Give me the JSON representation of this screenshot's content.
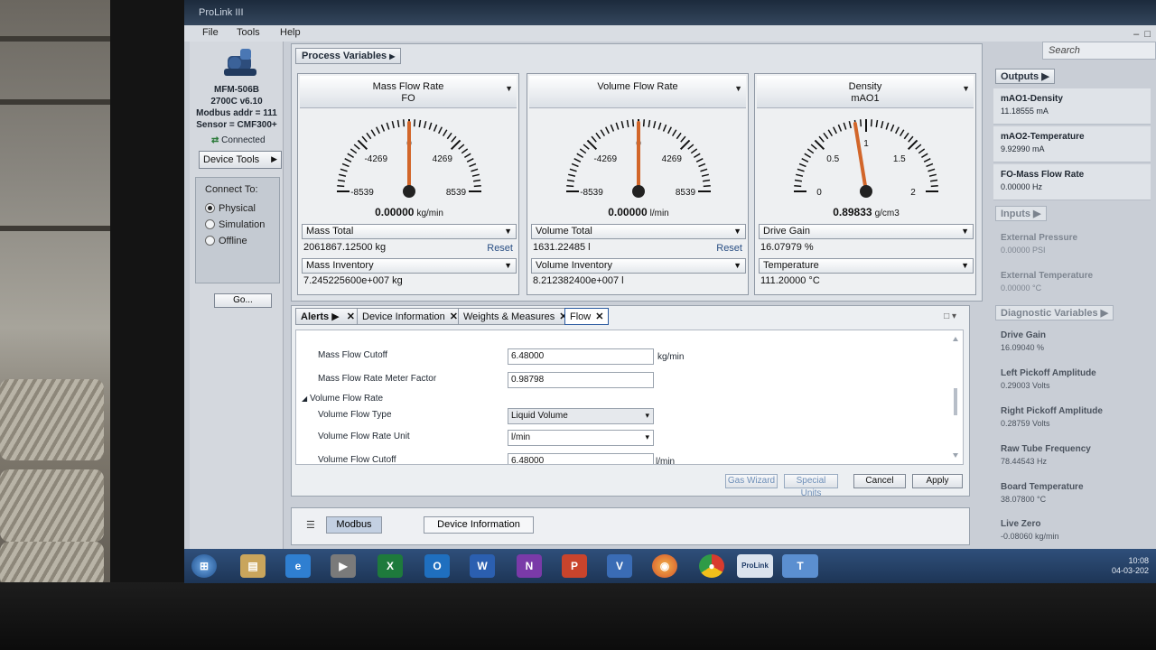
{
  "app": {
    "title": "ProLink III"
  },
  "menu": {
    "file": "File",
    "tools": "Tools",
    "help": "Help"
  },
  "search": {
    "placeholder": "Search"
  },
  "device": {
    "model": "MFM-506B",
    "version": "2700C v6.10",
    "modbus": "Modbus addr = 111",
    "sensor": "Sensor = CMF300+",
    "status": "Connected",
    "tools_label": "Device Tools"
  },
  "connect": {
    "label": "Connect To:",
    "options": [
      "Physical",
      "Simulation",
      "Offline"
    ],
    "selected": "Physical",
    "go_label": "Go..."
  },
  "process_variables": {
    "title": "Process Variables",
    "gauges": [
      {
        "name": "Mass Flow Rate",
        "sub": "FO",
        "ticks": [
          "-8539",
          "-4269",
          "0",
          "4269",
          "8539"
        ],
        "value": "0.00000",
        "unit": "kg/min",
        "needle_fraction": 0.5,
        "total_label": "Mass Total",
        "total_value": "2061867.12500 kg",
        "reset": "Reset",
        "inv_label": "Mass Inventory",
        "inv_value": "7.245225600e+007 kg"
      },
      {
        "name": "Volume Flow Rate",
        "sub": "",
        "ticks": [
          "-8539",
          "-4269",
          "0",
          "4269",
          "8539"
        ],
        "value": "0.00000",
        "unit": "l/min",
        "needle_fraction": 0.5,
        "total_label": "Volume Total",
        "total_value": "1631.22485 l",
        "reset": "Reset",
        "inv_label": "Volume Inventory",
        "inv_value": "8.212382400e+007 l"
      },
      {
        "name": "Density",
        "sub": "mAO1",
        "ticks": [
          "0",
          "0.5",
          "1",
          "1.5",
          "2"
        ],
        "value": "0.89833",
        "unit": "g/cm3",
        "needle_fraction": 0.449,
        "total_label": "Drive Gain",
        "total_value": "16.07979 %",
        "reset": "",
        "inv_label": "Temperature",
        "inv_value": "111.20000 °C"
      }
    ]
  },
  "outputs": {
    "title": "Outputs",
    "items": [
      {
        "name": "mAO1-Density",
        "value": "11.18555  mA"
      },
      {
        "name": "mAO2-Temperature",
        "value": "9.92990  mA"
      },
      {
        "name": "FO-Mass Flow Rate",
        "value": "0.00000  Hz"
      }
    ]
  },
  "inputs": {
    "title": "Inputs",
    "items": [
      {
        "name": "External Pressure",
        "value": "0.00000  PSI"
      },
      {
        "name": "External Temperature",
        "value": "0.00000  °C"
      }
    ]
  },
  "diagnostics": {
    "title": "Diagnostic Variables",
    "items": [
      {
        "name": "Drive Gain",
        "value": "16.09040  %"
      },
      {
        "name": "Left Pickoff Amplitude",
        "value": "0.29003  Volts"
      },
      {
        "name": "Right Pickoff Amplitude",
        "value": "0.28759  Volts"
      },
      {
        "name": "Raw Tube Frequency",
        "value": "78.44543  Hz"
      },
      {
        "name": "Board Temperature",
        "value": "38.07800  °C"
      },
      {
        "name": "Live Zero",
        "value": "-0.08060  kg/min"
      }
    ]
  },
  "tabs": [
    {
      "label": "Alerts",
      "active": false
    },
    {
      "label": "Device Information",
      "active": false
    },
    {
      "label": "Weights & Measures",
      "active": false
    },
    {
      "label": "Flow",
      "active": true
    }
  ],
  "flow_form": {
    "mass_cutoff_label": "Mass Flow Cutoff",
    "mass_cutoff_value": "6.48000",
    "mass_cutoff_unit": "kg/min",
    "meter_factor_label": "Mass Flow Rate Meter Factor",
    "meter_factor_value": "0.98798",
    "vol_group_label": "Volume Flow Rate",
    "vol_type_label": "Volume Flow Type",
    "vol_type_value": "Liquid Volume",
    "vol_unit_label": "Volume Flow Rate Unit",
    "vol_unit_value": "l/min",
    "vol_cutoff_label": "Volume Flow Cutoff",
    "vol_cutoff_value": "6.48000",
    "vol_cutoff_unit": "l/min"
  },
  "buttons": {
    "gas_wizard": "Gas Wizard",
    "special_units": "Special Units",
    "cancel": "Cancel",
    "apply": "Apply"
  },
  "bottom": {
    "modbus": "Modbus",
    "device_info": "Device Information"
  },
  "clock": {
    "time": "10:08",
    "date": "04-03-202"
  },
  "taskbar": [
    "start",
    "explorer",
    "ie",
    "media",
    "excel",
    "outlook",
    "word",
    "onenote",
    "powerpoint",
    "visio",
    "firefox",
    "chrome",
    "prolink",
    "teams"
  ]
}
